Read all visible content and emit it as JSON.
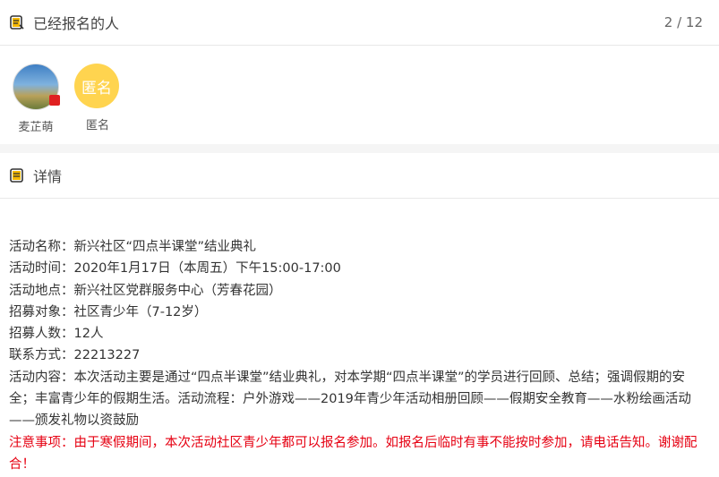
{
  "signup": {
    "title": "已经报名的人",
    "count": "2 / 12",
    "people": [
      {
        "name": "麦芷萌",
        "avatar": "photo"
      },
      {
        "name": "匿名",
        "avatar_text": "匿名"
      }
    ]
  },
  "details": {
    "title": "详情",
    "lines": [
      "活动名称：新兴社区“四点半课堂”结业典礼",
      "活动时间：2020年1月17日（本周五）下午15:00-17:00",
      "活动地点：新兴社区党群服务中心（芳春花园）",
      "招募对象：社区青少年（7-12岁）",
      "招募人数：12人",
      "联系方式：22213227",
      "活动内容：本次活动主要是通过“四点半课堂”结业典礼，对本学期“四点半课堂”的学员进行回顾、总结；强调假期的安全；丰富青少年的假期生活。活动流程：户外游戏——2019年青少年活动相册回顾——假期安全教育——水粉绘画活动——颁发礼物以资鼓励"
    ],
    "notice": "注意事项：由于寒假期间，本次活动社区青少年都可以报名参加。如报名后临时有事不能按时参加，请电话告知。谢谢配合！"
  },
  "colors": {
    "accent": "#ffd44f",
    "notice": "#e60012"
  }
}
